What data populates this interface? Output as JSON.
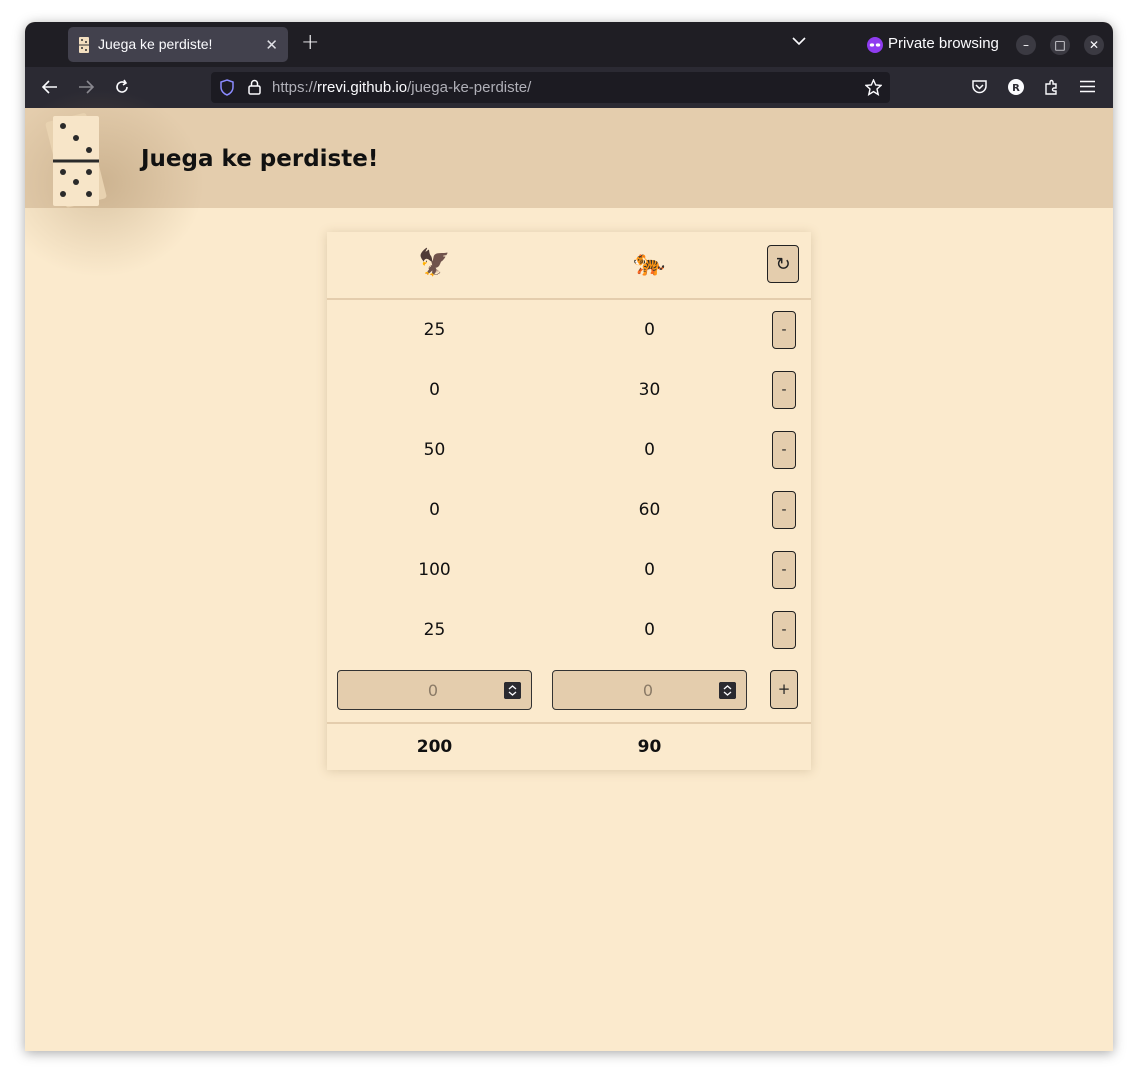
{
  "browser": {
    "tab_title": "Juega ke perdiste!",
    "private_label": "Private browsing",
    "url_prefix": "https://",
    "url_host": "rrevi.github.io",
    "url_path": "/juega-ke-perdiste/"
  },
  "page": {
    "title": "Juega ke perdiste!"
  },
  "scoreboard": {
    "players": [
      {
        "icon": "🦅",
        "name_icon": "eagle-icon"
      },
      {
        "icon": "🐅",
        "name_icon": "tiger-icon"
      }
    ],
    "reset_label": "↻",
    "rows": [
      {
        "a": "25",
        "b": "0",
        "remove": "-"
      },
      {
        "a": "0",
        "b": "30",
        "remove": "-"
      },
      {
        "a": "50",
        "b": "0",
        "remove": "-"
      },
      {
        "a": "0",
        "b": "60",
        "remove": "-"
      },
      {
        "a": "100",
        "b": "0",
        "remove": "-"
      },
      {
        "a": "25",
        "b": "0",
        "remove": "-"
      }
    ],
    "input_a_value": "0",
    "input_b_value": "0",
    "add_label": "+",
    "total_a": "200",
    "total_b": "90"
  }
}
